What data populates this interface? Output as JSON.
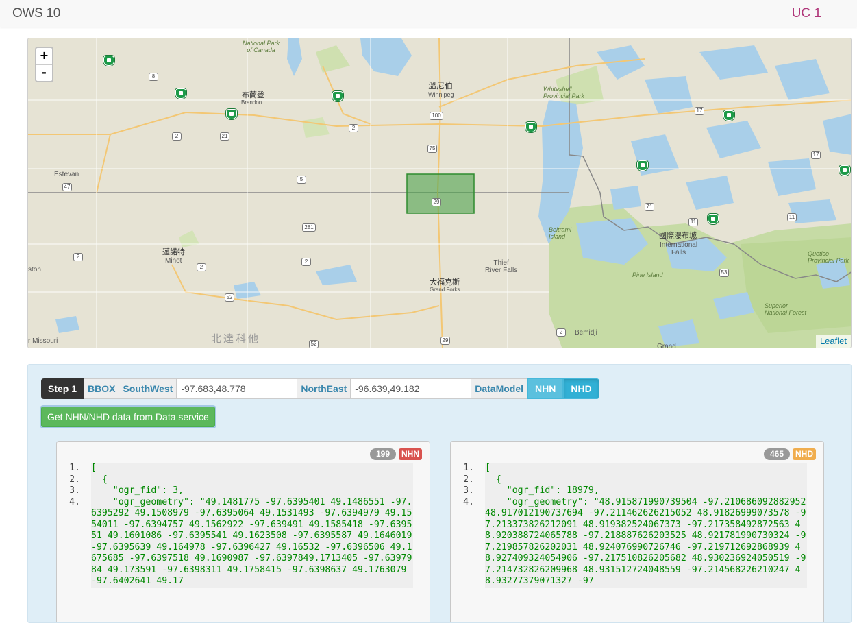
{
  "header": {
    "brand": "OWS 10",
    "uc": "UC 1"
  },
  "map": {
    "zoom_in": "+",
    "zoom_out": "-",
    "attribution": "Leaflet",
    "labels": {
      "national_park": "National Park\nof Canada",
      "whiteshell": "Whiteshell\nProvincial Park",
      "brandon_cn": "布蘭登",
      "brandon": "Brandon",
      "winnipeg_cn": "溫尼伯",
      "winnipeg": "Winnipeg",
      "estevan": "Estevan",
      "minot_cn": "邁諾特",
      "minot": "Minot",
      "ston": "ston",
      "thief": "Thief\nRiver Falls",
      "grand_forks_cn": "大福克斯",
      "grand_forks": "Grand Forks",
      "intl_falls_cn": "國際瀑布城",
      "intl_falls": "International\nFalls",
      "beltrami": "Beltrami\nIsland",
      "pine_island": "Pine Island",
      "quetico": "Quetico\nProvincial Park",
      "superior": "Superior\nNational Forest",
      "north_dakota": "北達科他",
      "missouri": "r Missouri",
      "bemidji": "Bemidji",
      "grand": "Grand"
    },
    "shields": [
      "2",
      "21",
      "2",
      "5",
      "75",
      "281",
      "2",
      "2",
      "52",
      "2",
      "52",
      "71",
      "11",
      "11",
      "53",
      "17",
      "17",
      "2",
      "29",
      "47",
      "100",
      "8",
      "29"
    ]
  },
  "toolbar": {
    "step": "Step 1",
    "bbox": "BBOX",
    "southwest_label": "SouthWest",
    "southwest_value": "-97.683,48.778",
    "northeast_label": "NorthEast",
    "northeast_value": "-96.639,49.182",
    "datamodel_label": "DataModel",
    "model_nhn": "NHN",
    "model_nhd": "NHD"
  },
  "get_button": "Get NHN/NHD data from Data service",
  "nhn_panel": {
    "count": "199",
    "tag": "NHN",
    "lines": [
      {
        "n": "1.",
        "t": "["
      },
      {
        "n": "2.",
        "t": "  {"
      },
      {
        "n": "3.",
        "t": "    \"ogr_fid\": 3,"
      },
      {
        "n": "4.",
        "t": "    \"ogr_geometry\": \"49.1481775 -97.6395401 49.1486551 -97.6395292 49.1508979 -97.6395064 49.1531493 -97.6394979 49.1554011 -97.6394757 49.1562922 -97.639491 49.1585418 -97.639551 49.1601086 -97.6395541 49.1623508 -97.6395587 49.1646019 -97.6395639 49.164978 -97.6396427 49.16532 -97.6396506 49.1675685 -97.6397518 49.1690987 -97.6397849.1713405 -97.6397984 49.173591 -97.6398311 49.1758415 -97.6398637 49.1763079 -97.6402641 49.17"
      }
    ]
  },
  "nhd_panel": {
    "count": "465",
    "tag": "NHD",
    "lines": [
      {
        "n": "1.",
        "t": "["
      },
      {
        "n": "2.",
        "t": "  {"
      },
      {
        "n": "3.",
        "t": "    \"ogr_fid\": 18979,"
      },
      {
        "n": "4.",
        "t": "    \"ogr_geometry\": \"48.915871990739504 -97.210686092882952 48.917012190737694 -97.211462626215052 48.91826999073578 -97.213373826212091 48.919382524067373 -97.217358492872563 48.920388724065788 -97.218887626203525 48.921781990730324 -97.219857826202031 48.924076990726746 -97.219712692868939 48.927409324054906 -97.217510826205682 48.930236924050519 -97.214732826209968 48.931512724048559 -97.214568226210247 48.93277379071327 -97"
      }
    ]
  },
  "colors": {
    "map_land": "#e4e1d2",
    "map_forest": "#c5d9a3",
    "map_water": "#a9cfe9",
    "bbox_fill": "#3f9d3f",
    "panel_bg": "#dfeef7",
    "code_green": "#008800"
  }
}
